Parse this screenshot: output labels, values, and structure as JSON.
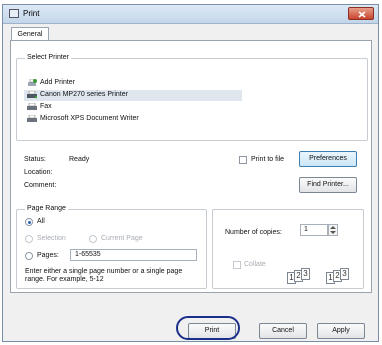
{
  "window": {
    "title": "Print",
    "tab_general": "General"
  },
  "select_printer": {
    "label": "Select Printer",
    "items": [
      {
        "label": "Add Printer",
        "icon": "add-printer-icon"
      },
      {
        "label": "Canon MP270 series Printer",
        "icon": "printer-icon",
        "selected": true
      },
      {
        "label": "Fax",
        "icon": "fax-icon"
      },
      {
        "label": "Microsoft XPS Document Writer",
        "icon": "printer-icon"
      }
    ]
  },
  "status": {
    "status_label": "Status:",
    "status_value": "Ready",
    "location_label": "Location:",
    "comment_label": "Comment:",
    "print_to_file": "Print to file",
    "preferences": "Preferences",
    "find_printer": "Find Printer..."
  },
  "page_range": {
    "label": "Page Range",
    "all": "All",
    "selection": "Selection",
    "current_page": "Current Page",
    "pages": "Pages:",
    "pages_value": "1-65535",
    "help": "Enter either a single page number or a single page range.  For example, 5-12"
  },
  "copies": {
    "label": "Number of copies:",
    "value": "1",
    "collate": "Collate"
  },
  "footer": {
    "print": "Print",
    "cancel": "Cancel",
    "apply": "Apply"
  }
}
